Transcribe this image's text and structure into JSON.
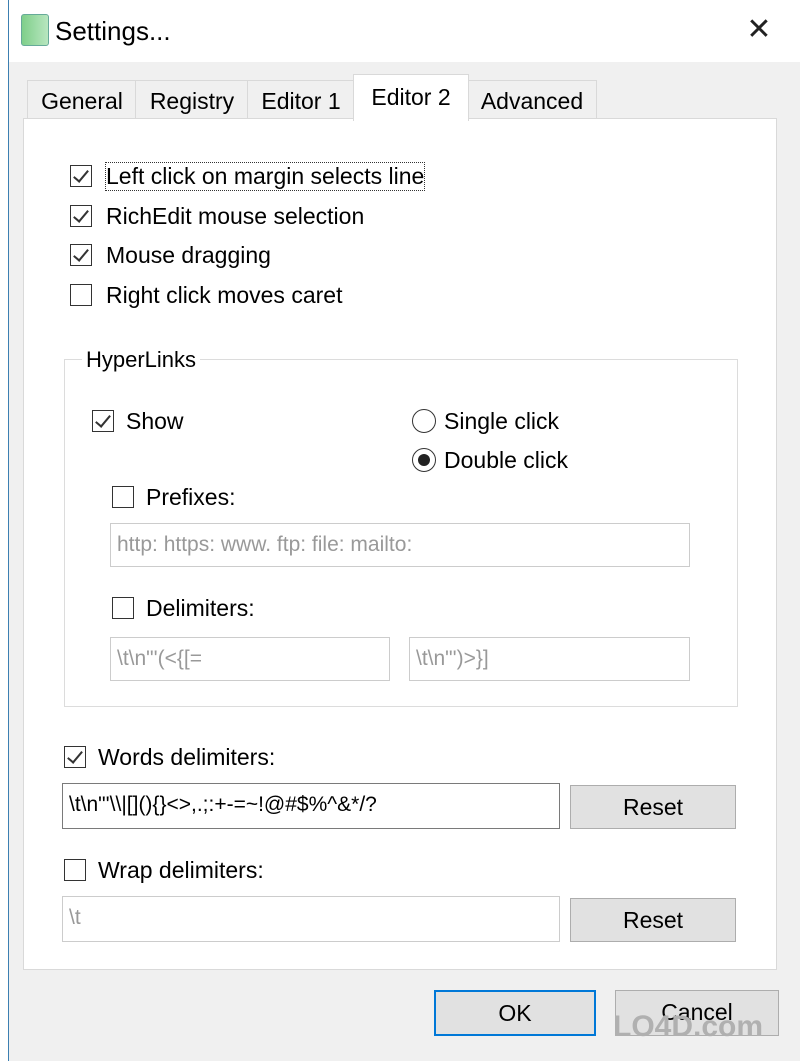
{
  "window": {
    "title": "Settings...",
    "close": "✕"
  },
  "tabs": [
    {
      "label": "General"
    },
    {
      "label": "Registry"
    },
    {
      "label": "Editor 1"
    },
    {
      "label": "Editor 2",
      "active": true
    },
    {
      "label": "Advanced"
    }
  ],
  "options": [
    {
      "label": "Left click on margin selects line",
      "checked": true
    },
    {
      "label": "RichEdit mouse selection",
      "checked": true
    },
    {
      "label": "Mouse dragging",
      "checked": true
    },
    {
      "label": "Right click moves caret",
      "checked": false
    }
  ],
  "hyperlinks": {
    "title": "HyperLinks",
    "show": {
      "label": "Show",
      "checked": true
    },
    "single_click": {
      "label": "Single click",
      "selected": false
    },
    "double_click": {
      "label": "Double click",
      "selected": true
    },
    "prefixes": {
      "label": "Prefixes:",
      "checked": false,
      "value": "http: https: www. ftp: file: mailto:"
    },
    "delimiters": {
      "label": "Delimiters:",
      "checked": false,
      "open_value": "\\t\\n\"'(<{[=",
      "close_value": "\\t\\n\"')>}]"
    }
  },
  "words_delimiters": {
    "label": "Words delimiters:",
    "checked": true,
    "value": "\\t\\n\"'\\\\|[](){}<>,.;:+-=~!@#$%^&*/?",
    "reset": "Reset"
  },
  "wrap_delimiters": {
    "label": "Wrap delimiters:",
    "checked": false,
    "value": "\\t",
    "reset": "Reset"
  },
  "footer": {
    "ok": "OK",
    "cancel": "Cancel"
  },
  "watermark": "LO4D.com"
}
